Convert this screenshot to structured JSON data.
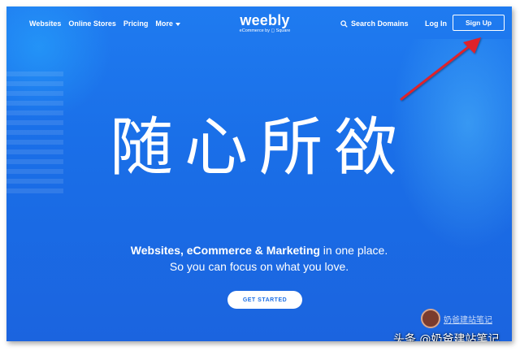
{
  "nav": {
    "links": [
      {
        "label": "Websites"
      },
      {
        "label": "Online Stores"
      },
      {
        "label": "Pricing"
      },
      {
        "label": "More"
      }
    ],
    "search_label": "Search Domains",
    "login_label": "Log In",
    "signup_label": "Sign Up"
  },
  "logo": {
    "word": "weebly",
    "sub": "eCommerce by ◻ Square"
  },
  "hero": {
    "headline": "随心所欲",
    "sub1_bold": "Websites, eCommerce & Marketing",
    "sub1_rest": " in one place.",
    "sub2": "So you can focus on what you love.",
    "cta_label": "GET STARTED"
  },
  "watermark": {
    "ribbon": "奶爸建站笔记",
    "text": "头条 @奶爸建站笔记"
  },
  "colors": {
    "background": "#1f7bf0",
    "cta_text": "#1c6fe6",
    "arrow": "#e0202a"
  },
  "icons": {
    "search": "search-icon",
    "more": "chevron-down-icon"
  }
}
